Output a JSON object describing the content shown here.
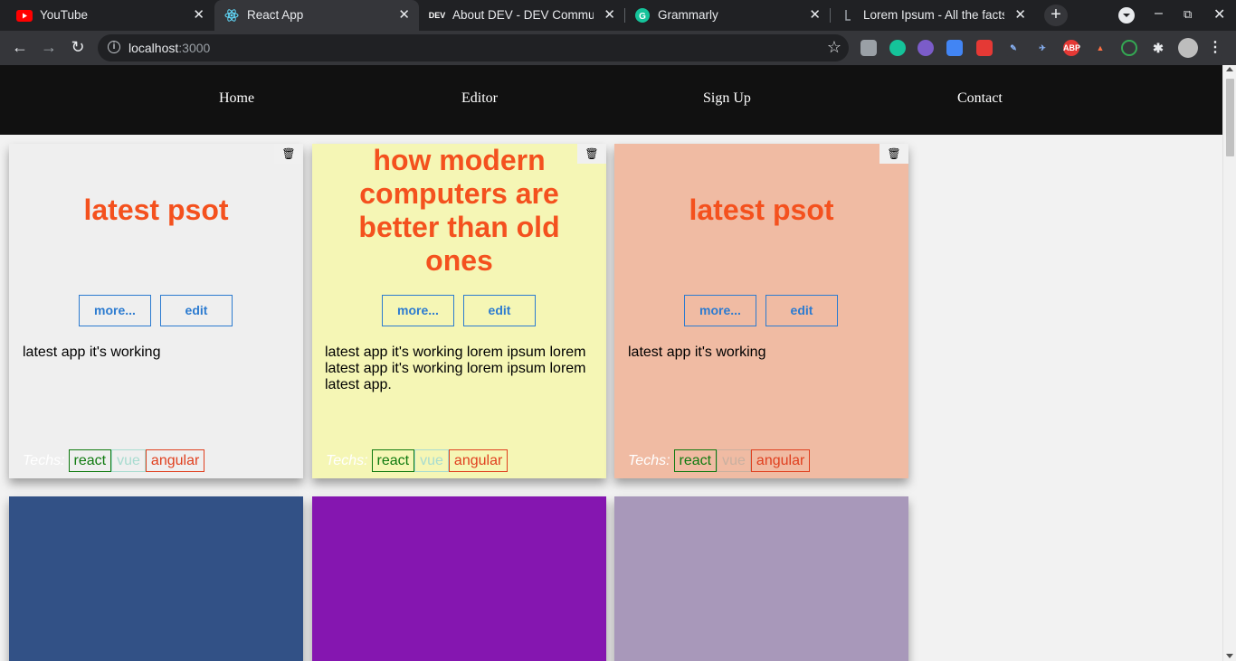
{
  "browser": {
    "tabs": [
      {
        "title": "YouTube",
        "icon": "youtube-icon",
        "active": false
      },
      {
        "title": "React App",
        "icon": "react-icon",
        "active": true
      },
      {
        "title": "About DEV - DEV Community",
        "icon": "dev-icon",
        "active": false
      },
      {
        "title": "Grammarly",
        "icon": "grammarly-icon",
        "active": false
      },
      {
        "title": "Lorem Ipsum - All the facts",
        "icon": "lorem-icon",
        "active": false
      }
    ],
    "url_host": "localhost",
    "url_port": ":3000",
    "dev_badge": "DEV",
    "abp_badge": "ABP"
  },
  "site_nav": {
    "links": [
      "Home",
      "Editor",
      "Sign Up",
      "Contact"
    ]
  },
  "cards": [
    {
      "title": "latest psot",
      "more_label": "more...",
      "edit_label": "edit",
      "description": "latest app it's working",
      "techs_label": "Techs:",
      "tags": [
        "react",
        "vue",
        "angular"
      ],
      "background": "#efefef"
    },
    {
      "title": "how modern computers are better than old ones",
      "more_label": "more...",
      "edit_label": "edit",
      "description": "latest app it's working lorem ipsum lorem latest app it's working lorem ipsum lorem latest app.",
      "techs_label": "Techs:",
      "tags": [
        "react",
        "vue",
        "angular"
      ],
      "background": "#f5f6b5"
    },
    {
      "title": "latest psot",
      "more_label": "more...",
      "edit_label": "edit",
      "description": "latest app it's working",
      "techs_label": "Techs:",
      "tags": [
        "react",
        "vue",
        "angular"
      ],
      "background": "#f0bba3"
    },
    {
      "background": "#325186"
    },
    {
      "background": "#8516b0"
    },
    {
      "background": "#a898ba"
    }
  ],
  "colors": {
    "accent_title": "#f4511e",
    "button_blue": "#2c7bd0",
    "nav_bg": "#111111"
  }
}
